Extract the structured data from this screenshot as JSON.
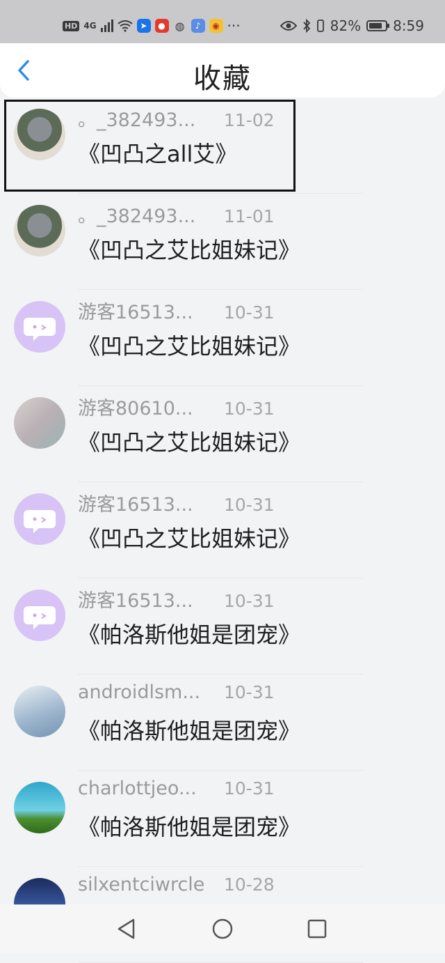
{
  "status_bar": {
    "network_badge": "HD",
    "network_type": "4G",
    "more": "···",
    "battery": "82%",
    "battery_level": 0.82,
    "time": "8:59",
    "icons": [
      "signal-icon",
      "wifi-icon",
      "app-send-icon",
      "app-red-icon",
      "wechat-icon",
      "music-icon",
      "weibo-icon",
      "eye-icon",
      "bluetooth-icon",
      "vibrate-icon",
      "battery-icon"
    ]
  },
  "header": {
    "title": "收藏",
    "back_icon": "chevron-left-icon"
  },
  "favorites": [
    {
      "username": "。_382493...",
      "date": "11-02",
      "title": "《凹凸之all艾》",
      "avatar": "av-kakashi"
    },
    {
      "username": "。_382493...",
      "date": "11-01",
      "title": "《凹凸之艾比姐妹记》",
      "avatar": "av-kakashi"
    },
    {
      "username": "游客16513...",
      "date": "10-31",
      "title": "《凹凸之艾比姐妹记》",
      "avatar": "av-guest"
    },
    {
      "username": "游客80610...",
      "date": "10-31",
      "title": "《凹凸之艾比姐妹记》",
      "avatar": "av-flag"
    },
    {
      "username": "游客16513...",
      "date": "10-31",
      "title": "《凹凸之艾比姐妹记》",
      "avatar": "av-guest"
    },
    {
      "username": "游客16513...",
      "date": "10-31",
      "title": "《帕洛斯他姐是团宠》",
      "avatar": "av-guest"
    },
    {
      "username": "androidlsm...",
      "date": "10-31",
      "title": "《帕洛斯他姐是团宠》",
      "avatar": "av-android"
    },
    {
      "username": "charlottjeo...",
      "date": "10-31",
      "title": "《帕洛斯他姐是团宠》",
      "avatar": "av-sky"
    },
    {
      "username": "silxentciwrcle",
      "date": "10-28",
      "title": "",
      "avatar": "av-anime"
    }
  ],
  "nav_bar": {
    "back": "triangle-back-icon",
    "home": "circle-home-icon",
    "recents": "square-recents-icon"
  }
}
